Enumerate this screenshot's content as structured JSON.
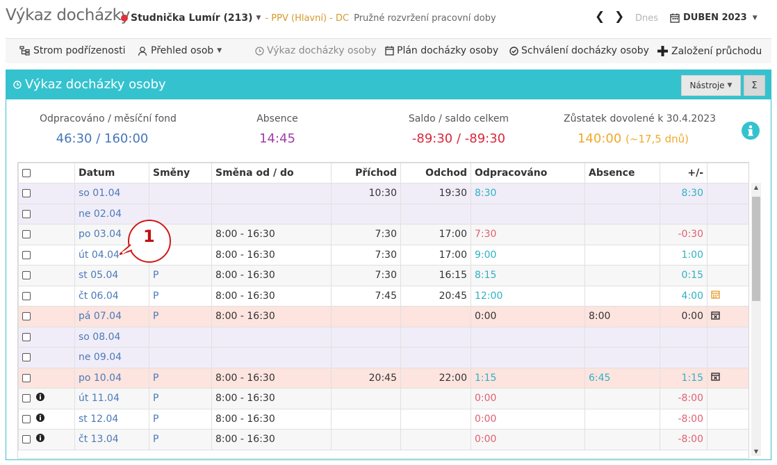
{
  "header": {
    "title": "Výkaz docházky",
    "employee": "Studnička Lumír (213)",
    "department": "- PPV (Hlavní) - DC",
    "work_time": "Pružné rozvržení pracovní doby",
    "today": "Dnes",
    "month": "DUBEN 2023"
  },
  "toolbar": {
    "tree": "Strom podřízenosti",
    "overview": "Přehled osob",
    "report": "Výkaz docházky osoby",
    "plan": "Plán docházky osoby",
    "approval": "Schválení docházky osoby",
    "create": "Založení průchodu"
  },
  "panel": {
    "title": "Výkaz docházky osoby",
    "tools": "Nástroje",
    "sigma": "Σ"
  },
  "summary": {
    "worked_label": "Odpracováno / měsíční fond",
    "worked_value": "46:30 / 160:00",
    "absence_label": "Absence",
    "absence_value": "14:45",
    "saldo_label": "Saldo / saldo celkem",
    "saldo_value": "-89:30 / -89:30",
    "vacation_label": "Zůstatek dovolené k 30.4.2023",
    "vacation_value": "140:00",
    "vacation_days": "(~17,5 dnů)"
  },
  "columns": [
    "Datum",
    "Směny",
    "Směna od / do",
    "Příchod",
    "Odchod",
    "Odpracováno",
    "Absence",
    "+/-"
  ],
  "rows": [
    {
      "date": "so 01.04",
      "shift": "",
      "range": "",
      "arrive": "10:30",
      "leave": "19:30",
      "worked": "8:30",
      "absence": "",
      "diff": "8:30",
      "type": "we",
      "worked_color": "t",
      "diff_color": "t",
      "icon": "",
      "info": false
    },
    {
      "date": "ne 02.04",
      "shift": "",
      "range": "",
      "arrive": "",
      "leave": "",
      "worked": "",
      "absence": "",
      "diff": "",
      "type": "we",
      "worked_color": "",
      "diff_color": "",
      "icon": "",
      "info": false
    },
    {
      "date": "po 03.04",
      "shift": "",
      "range": "8:00 - 16:30",
      "arrive": "7:30",
      "leave": "17:00",
      "worked": "7:30",
      "absence": "",
      "diff": "-0:30",
      "type": "odd",
      "worked_color": "r",
      "diff_color": "r",
      "icon": "",
      "info": false
    },
    {
      "date": "út 04.04",
      "shift": "",
      "range": "8:00 - 16:30",
      "arrive": "7:30",
      "leave": "17:00",
      "worked": "9:00",
      "absence": "",
      "diff": "1:00",
      "type": "even",
      "worked_color": "t",
      "diff_color": "t",
      "icon": "",
      "info": false
    },
    {
      "date": "st 05.04",
      "shift": "P",
      "range": "8:00 - 16:30",
      "arrive": "7:30",
      "leave": "16:15",
      "worked": "8:15",
      "absence": "",
      "diff": "0:15",
      "type": "odd",
      "worked_color": "t",
      "diff_color": "t",
      "icon": "",
      "info": false
    },
    {
      "date": "čt 06.04",
      "shift": "P",
      "range": "8:00 - 16:30",
      "arrive": "7:45",
      "leave": "20:45",
      "worked": "12:00",
      "absence": "",
      "diff": "4:00",
      "type": "even",
      "worked_color": "t",
      "diff_color": "t",
      "icon": "calendar-orange",
      "info": false
    },
    {
      "date": "pá 07.04",
      "shift": "P",
      "range": "8:00 - 16:30",
      "arrive": "",
      "leave": "",
      "worked": "0:00",
      "absence": "8:00",
      "diff": "0:00",
      "type": "hol",
      "worked_color": "",
      "diff_color": "",
      "icon": "calendar-x",
      "info": false
    },
    {
      "date": "so 08.04",
      "shift": "",
      "range": "",
      "arrive": "",
      "leave": "",
      "worked": "",
      "absence": "",
      "diff": "",
      "type": "we",
      "worked_color": "",
      "diff_color": "",
      "icon": "",
      "info": false
    },
    {
      "date": "ne 09.04",
      "shift": "",
      "range": "",
      "arrive": "",
      "leave": "",
      "worked": "",
      "absence": "",
      "diff": "",
      "type": "we",
      "worked_color": "",
      "diff_color": "",
      "icon": "",
      "info": false
    },
    {
      "date": "po 10.04",
      "shift": "P",
      "range": "8:00 - 16:30",
      "arrive": "20:45",
      "leave": "22:00",
      "worked": "1:15",
      "absence": "6:45",
      "diff": "1:15",
      "type": "hol",
      "worked_color": "t",
      "diff_color": "t",
      "absence_color": "t",
      "icon": "calendar-x",
      "info": false
    },
    {
      "date": "út 11.04",
      "shift": "P",
      "range": "8:00 - 16:30",
      "arrive": "",
      "leave": "",
      "worked": "0:00",
      "absence": "",
      "diff": "-8:00",
      "type": "odd",
      "worked_color": "r",
      "diff_color": "r",
      "icon": "",
      "info": true
    },
    {
      "date": "st 12.04",
      "shift": "P",
      "range": "8:00 - 16:30",
      "arrive": "",
      "leave": "",
      "worked": "0:00",
      "absence": "",
      "diff": "-8:00",
      "type": "even",
      "worked_color": "r",
      "diff_color": "r",
      "icon": "",
      "info": true
    },
    {
      "date": "čt 13.04",
      "shift": "P",
      "range": "8:00 - 16:30",
      "arrive": "",
      "leave": "",
      "worked": "0:00",
      "absence": "",
      "diff": "-8:00",
      "type": "odd",
      "worked_color": "r",
      "diff_color": "r",
      "icon": "",
      "info": true
    }
  ],
  "callout": "1",
  "colors": {
    "accent": "#35c2cf",
    "teal_value": "#2fb1c3",
    "red_value": "#e06070",
    "weekend_row": "#f1edf8",
    "holiday_row": "#fde4df"
  },
  "icons": [
    "hierarchy-icon",
    "person-search-icon",
    "clock-icon",
    "calendar-icon",
    "check-circle-icon",
    "plus-icon",
    "info-icon",
    "calendar-x-icon"
  ]
}
